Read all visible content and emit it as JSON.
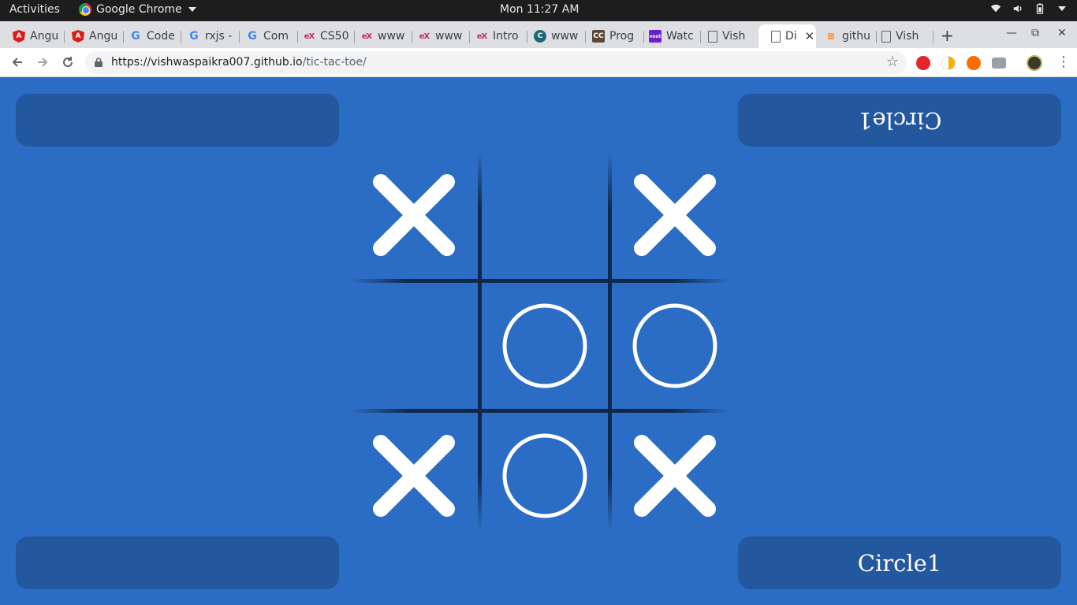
{
  "system": {
    "activities": "Activities",
    "app_name": "Google Chrome",
    "clock": "Mon 11:27 AM"
  },
  "tabs": [
    {
      "label": "Angu",
      "icon": "angular-icon"
    },
    {
      "label": "Angu",
      "icon": "angular-icon"
    },
    {
      "label": "Code",
      "icon": "google-icon"
    },
    {
      "label": "rxjs -",
      "icon": "google-icon"
    },
    {
      "label": "Com",
      "icon": "google-icon"
    },
    {
      "label": "CS50",
      "icon": "edx-icon"
    },
    {
      "label": "www",
      "icon": "edx-icon"
    },
    {
      "label": "www",
      "icon": "edx-icon"
    },
    {
      "label": "Intro",
      "icon": "edx-icon"
    },
    {
      "label": "www",
      "icon": "codecademy-icon"
    },
    {
      "label": "Prog",
      "icon": "codechef-icon"
    },
    {
      "label": "Watc",
      "icon": "voot-icon"
    },
    {
      "label": "Vish",
      "icon": "document-icon"
    },
    {
      "label": "Di",
      "icon": "document-icon",
      "active": true
    },
    {
      "label": "githu",
      "icon": "stackoverflow-icon"
    },
    {
      "label": "Vish",
      "icon": "document-icon"
    }
  ],
  "toolbar": {
    "url_host": "https://vishwaspaikra007.github.io",
    "url_path": "/tic-tac-toe/"
  },
  "game": {
    "player_top_left": "",
    "player_top_right": "Circle1",
    "player_bottom_left": "",
    "player_bottom_right": "Circle1",
    "board": [
      [
        "X",
        "",
        "X"
      ],
      [
        "",
        "O",
        "O"
      ],
      [
        "X",
        "O",
        "X"
      ]
    ]
  },
  "colors": {
    "page_background": "#2b6cc4",
    "panel": "#23579e",
    "grid_line": "#10294a",
    "mark": "#ffffff"
  }
}
